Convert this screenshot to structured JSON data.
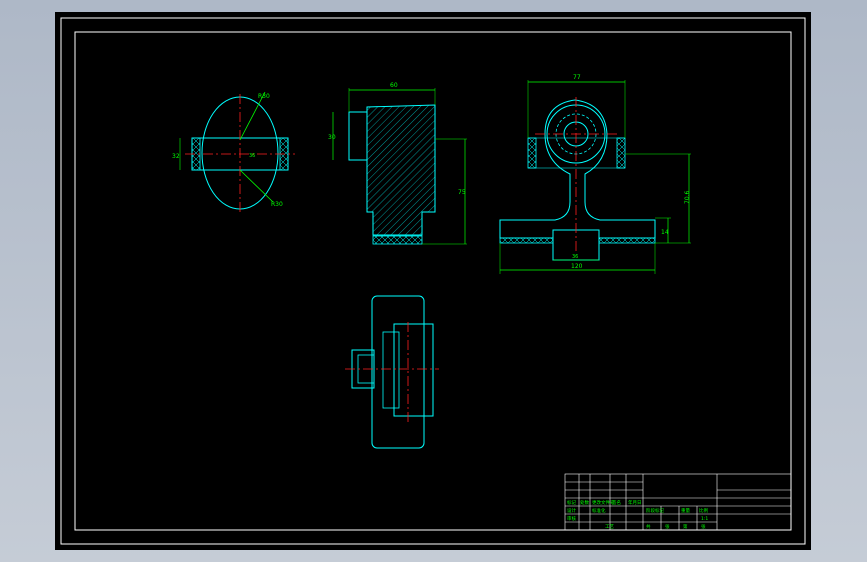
{
  "drawing": {
    "title_block": {
      "row_labels": [
        "标记",
        "处数",
        "分区",
        "更改文件号",
        "签名",
        "年月日"
      ],
      "labels": [
        "设计",
        "标准化",
        "阶段标记",
        "重量",
        "比例",
        "审核",
        "工艺",
        "批准"
      ],
      "scale": "1:1",
      "sheet": [
        "共",
        "张",
        "第",
        "张"
      ]
    },
    "dimensions": {
      "top_width_left": "60",
      "top_width_right": "77",
      "height_left": "30",
      "height_right": "75",
      "base_width": "120",
      "neck_width": "36",
      "total_height": "70.6",
      "base_height": "14",
      "side_height": "32",
      "bore_dia": "36",
      "radius_top": "R30",
      "radius_bottom": "R30"
    }
  }
}
